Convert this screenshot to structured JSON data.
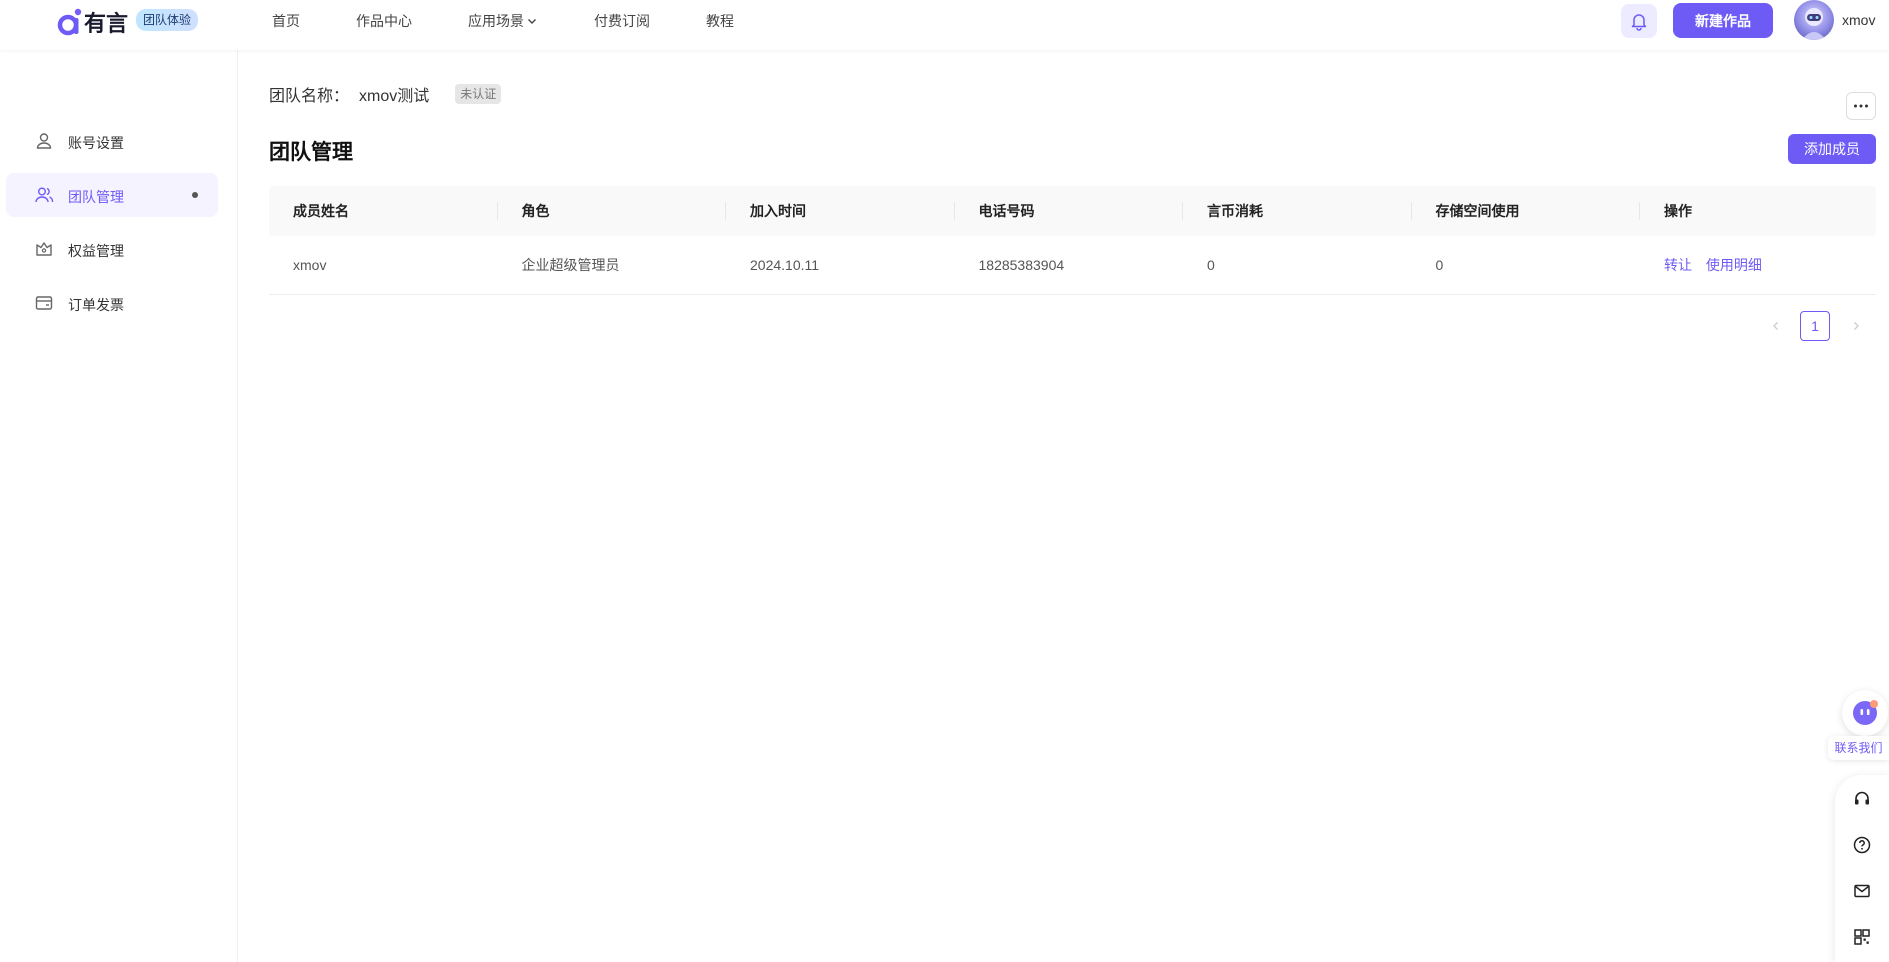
{
  "header": {
    "brand": "有言",
    "team_badge": "团队体验",
    "nav": [
      {
        "label": "首页"
      },
      {
        "label": "作品中心"
      },
      {
        "label": "应用场景"
      },
      {
        "label": "付费订阅"
      },
      {
        "label": "教程"
      }
    ],
    "new_work_label": "新建作品",
    "username": "xmov"
  },
  "sidebar": {
    "items": [
      {
        "label": "账号设置",
        "icon": "user-icon"
      },
      {
        "label": "团队管理",
        "icon": "team-icon",
        "active": true
      },
      {
        "label": "权益管理",
        "icon": "benefits-icon"
      },
      {
        "label": "订单发票",
        "icon": "wallet-icon"
      }
    ]
  },
  "team": {
    "name_label": "团队名称：",
    "name_value": "xmov测试",
    "cert_status": "未认证"
  },
  "section": {
    "title": "团队管理",
    "add_member_label": "添加成员"
  },
  "table": {
    "columns": [
      "成员姓名",
      "角色",
      "加入时间",
      "电话号码",
      "言币消耗",
      "存储空间使用",
      "操作"
    ],
    "rows": [
      {
        "name": "xmov",
        "role": "企业超级管理员",
        "joined": "2024.10.11",
        "phone": "18285383904",
        "coins": "0",
        "storage": "0",
        "actions": [
          "转让",
          "使用明细"
        ]
      }
    ]
  },
  "pagination": {
    "current": "1"
  },
  "floating": {
    "contact_label": "联系我们"
  },
  "colors": {
    "accent": "#6e5bf5",
    "accent_light": "#ecebff"
  }
}
